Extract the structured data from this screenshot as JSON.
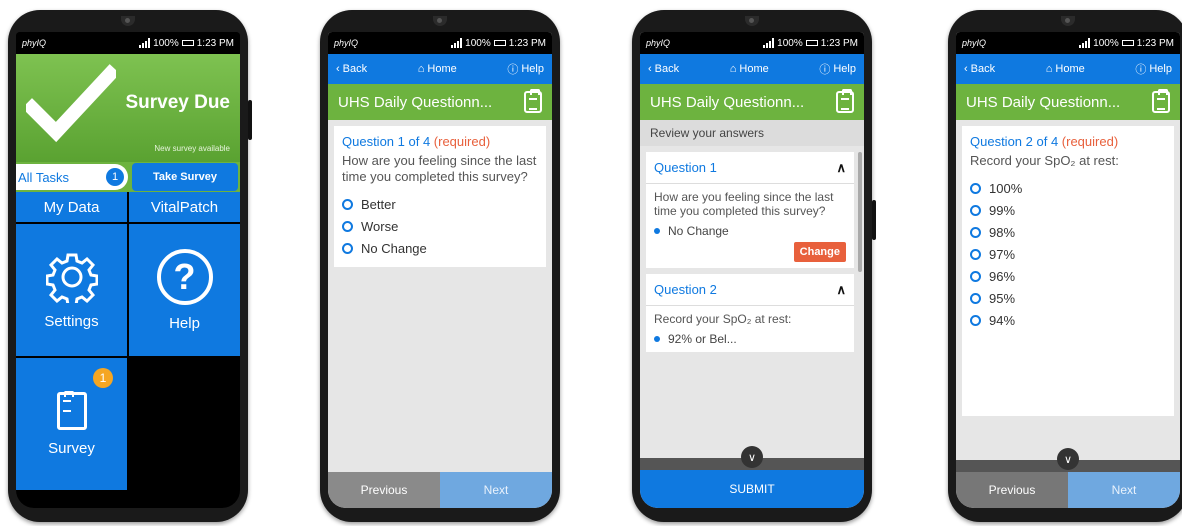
{
  "status": {
    "brand": "phyIQ",
    "battery": "100%",
    "time": "1:23 PM"
  },
  "nav": {
    "back": "Back",
    "home": "Home",
    "help": "Help"
  },
  "survey_title": "UHS Daily Questionn...",
  "phone1": {
    "banner_title": "Survey Due",
    "banner_sub": "New survey available",
    "all_tasks": "All Tasks",
    "task_count": "1",
    "take_survey": "Take Survey",
    "tiles": {
      "my_data": "My Data",
      "vitalpatch": "VitalPatch",
      "settings": "Settings",
      "help": "Help",
      "survey": "Survey"
    },
    "survey_badge": "1"
  },
  "phone2": {
    "question_head": "Question 1 of 4",
    "required": "(required)",
    "question_text": "How are you feeling since the last time you completed this survey?",
    "options": [
      "Better",
      "Worse",
      "No Change"
    ],
    "prev": "Previous",
    "next": "Next"
  },
  "phone3": {
    "review_head": "Review your answers",
    "q1_label": "Question 1",
    "q1_text": "How are you feeling since the last time you completed this survey?",
    "q1_answer": "No Change",
    "change": "Change",
    "q2_label": "Question 2",
    "q2_text": "Record your SpO₂ at rest:",
    "q2_answer": "92% or Bel...",
    "submit": "SUBMIT"
  },
  "phone4": {
    "question_head": "Question 2 of 4",
    "required": "(required)",
    "question_text": "Record your SpO₂ at rest:",
    "options": [
      "100%",
      "99%",
      "98%",
      "97%",
      "96%",
      "95%",
      "94%"
    ],
    "prev": "Previous",
    "next": "Next"
  }
}
